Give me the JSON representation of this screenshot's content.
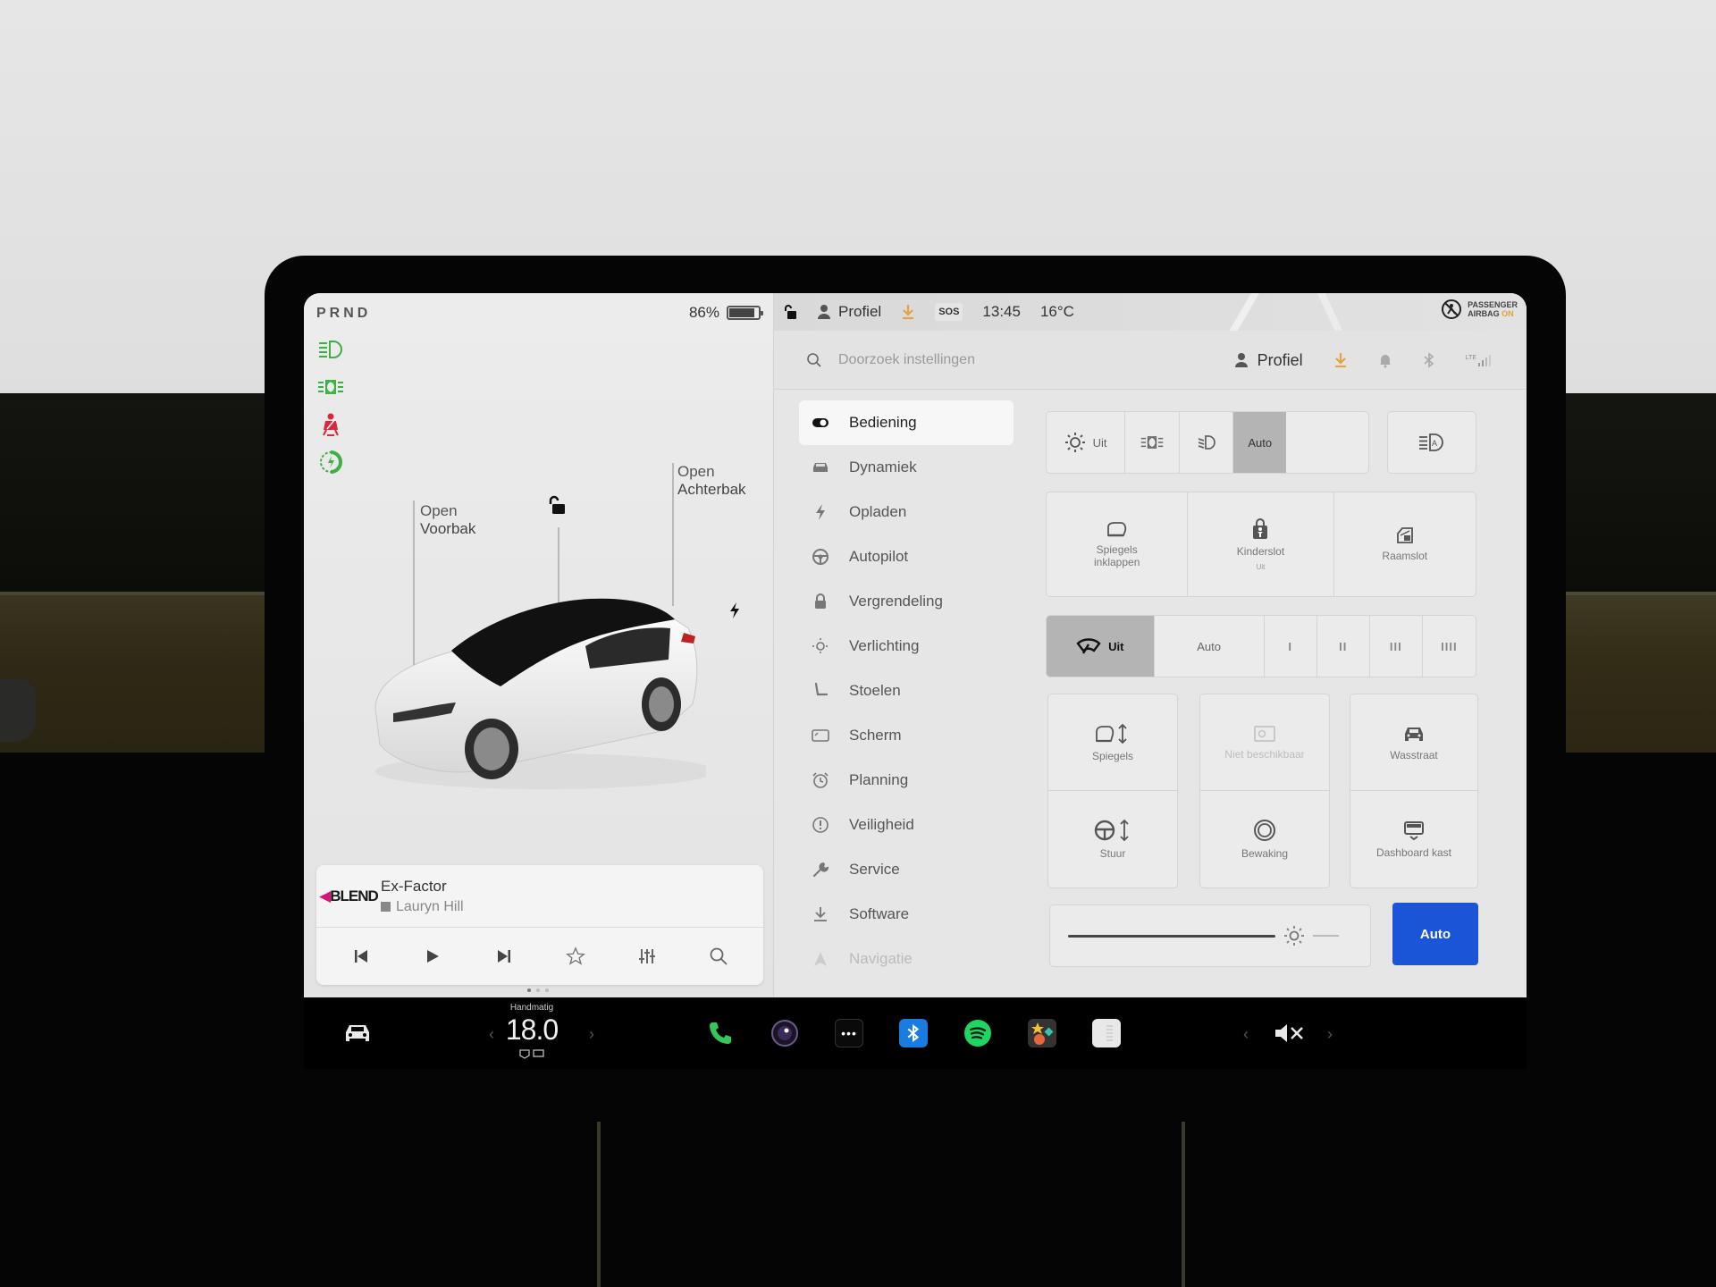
{
  "left_panel": {
    "gear": "PRND",
    "battery_percent_label": "86%",
    "battery_level": 0.86,
    "telltales": [
      {
        "icon": "high-beam-icon",
        "color": "#3cb043"
      },
      {
        "icon": "parking-lights-icon",
        "color": "#3cb043"
      },
      {
        "icon": "seatbelt-warning-icon",
        "color": "#e0243a"
      },
      {
        "icon": "regen-charging-icon",
        "color": "#3cb043"
      }
    ],
    "frunk_label": {
      "line1": "Open",
      "line2": "Voorbak"
    },
    "trunk_label": {
      "line1": "Open",
      "line2": "Achterbak"
    }
  },
  "media": {
    "source_logo": "BLEND",
    "title": "Ex-Factor",
    "artist": "Lauryn Hill",
    "controls": [
      "previous",
      "play",
      "next",
      "favorite",
      "equalizer",
      "search"
    ],
    "page_indicator": {
      "count": 3,
      "active": 1
    }
  },
  "status_bar": {
    "profile": "Profiel",
    "sos": "SOS",
    "time": "13:45",
    "temperature": "16°C",
    "airbag_line1": "PASSENGER",
    "airbag_line2": "AIRBAG",
    "airbag_state": "ON",
    "accent_color": "#e8a23c"
  },
  "search": {
    "placeholder": "Doorzoek instellingen",
    "profile": "Profiel",
    "lte_label": "LTE"
  },
  "menu": {
    "items": [
      {
        "label": "Bediening",
        "icon": "toggle-icon",
        "active": true
      },
      {
        "label": "Dynamiek",
        "icon": "car-icon"
      },
      {
        "label": "Opladen",
        "icon": "bolt-icon"
      },
      {
        "label": "Autopilot",
        "icon": "steering-wheel-icon"
      },
      {
        "label": "Vergrendeling",
        "icon": "lock-icon"
      },
      {
        "label": "Verlichting",
        "icon": "sun-icon"
      },
      {
        "label": "Stoelen",
        "icon": "seat-icon"
      },
      {
        "label": "Scherm",
        "icon": "display-icon"
      },
      {
        "label": "Planning",
        "icon": "alarm-clock-icon"
      },
      {
        "label": "Veiligheid",
        "icon": "alert-circle-icon"
      },
      {
        "label": "Service",
        "icon": "wrench-icon"
      },
      {
        "label": "Software",
        "icon": "download-icon"
      },
      {
        "label": "Navigatie",
        "icon": "navigation-icon",
        "faded": true
      }
    ]
  },
  "controls": {
    "lights": {
      "options": [
        {
          "label": "Uit",
          "icon": "light-off-icon"
        },
        {
          "label": "",
          "icon": "parking-lights-icon"
        },
        {
          "label": "",
          "icon": "low-beam-icon"
        },
        {
          "label": "Auto",
          "icon": "",
          "selected": true
        }
      ],
      "auto_high_beam_icon": "auto-high-beam-icon"
    },
    "tiles_row1": [
      {
        "label": "Spiegels inklappen",
        "icon": "mirror-fold-icon"
      },
      {
        "label": "Kinderslot",
        "sub": "Uit",
        "icon": "child-lock-icon"
      },
      {
        "label": "Raamslot",
        "icon": "window-lock-icon"
      }
    ],
    "wipers": {
      "options": [
        {
          "label": "Uit",
          "icon": "wiper-icon",
          "selected": true
        },
        {
          "label": "Auto"
        },
        {
          "label": "I"
        },
        {
          "label": "II"
        },
        {
          "label": "III"
        },
        {
          "label": "IIII"
        }
      ]
    },
    "tiles_grid": [
      {
        "label": "Spiegels",
        "icon": "mirror-adjust-icon"
      },
      {
        "label": "Stuur",
        "icon": "steering-adjust-icon"
      },
      {
        "label": "Niet beschikbaar",
        "icon": "dashcam-icon",
        "disabled": true
      },
      {
        "label": "Bewaking",
        "icon": "sentry-icon"
      },
      {
        "label": "Wasstraat",
        "icon": "car-wash-icon"
      },
      {
        "label": "Dashboard kast",
        "icon": "glovebox-icon"
      }
    ],
    "brightness": {
      "level": 0.8,
      "auto_label": "Auto",
      "auto_color": "#1a55d8"
    }
  },
  "taskbar": {
    "climate_mode": "Handmatig",
    "temperature": "18.0",
    "apps": [
      {
        "name": "phone",
        "color": "#34c759"
      },
      {
        "name": "camera",
        "color": "#3a2a5a"
      },
      {
        "name": "more",
        "color": "#111111"
      },
      {
        "name": "bluetooth",
        "color": "#1a7be0"
      },
      {
        "name": "spotify",
        "color": "#1ed760"
      },
      {
        "name": "toybox",
        "color": "#333333"
      },
      {
        "name": "calendar",
        "color": "#e8e8e8"
      }
    ],
    "volume_state": "muted"
  }
}
